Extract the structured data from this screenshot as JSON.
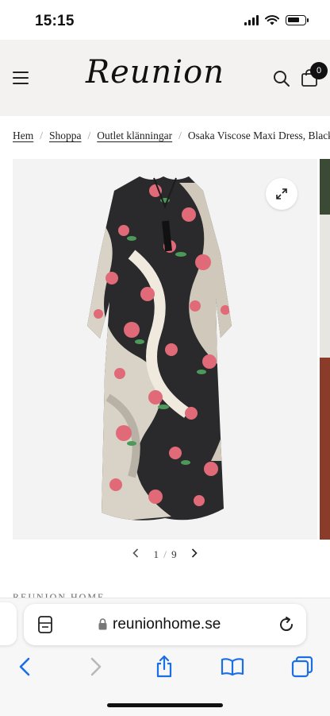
{
  "status_bar": {
    "time": "15:15"
  },
  "header": {
    "logo": "Reunion",
    "cart_count": "0"
  },
  "breadcrumb": [
    {
      "label": "Hem",
      "link": true
    },
    {
      "label": "Shoppa",
      "link": true
    },
    {
      "label": "Outlet klänningar",
      "link": true
    },
    {
      "label": "Osaka Viscose Maxi Dress, Black",
      "link": false
    }
  ],
  "gallery": {
    "image_index": "1",
    "image_total": "9",
    "separator": "/"
  },
  "brand_label": "REUNION HOME",
  "browser": {
    "url": "reunionhome.se"
  },
  "colors": {
    "header_bg": "#f3f2f1",
    "accent": "#1a6ee6",
    "text": "#111111"
  }
}
